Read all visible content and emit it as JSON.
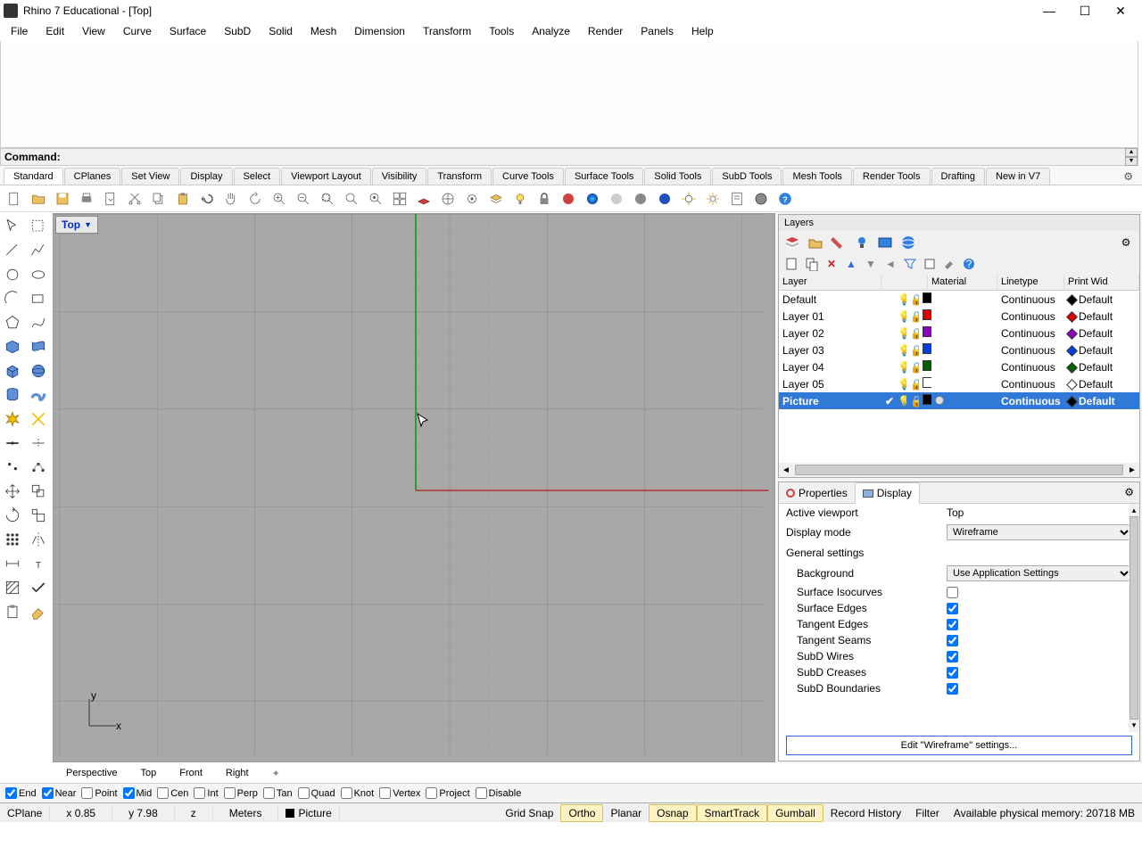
{
  "title": "Rhino 7 Educational - [Top]",
  "menu": [
    "File",
    "Edit",
    "View",
    "Curve",
    "Surface",
    "SubD",
    "Solid",
    "Mesh",
    "Dimension",
    "Transform",
    "Tools",
    "Analyze",
    "Render",
    "Panels",
    "Help"
  ],
  "command_label": "Command:",
  "command_value": "",
  "tabs": [
    "Standard",
    "CPlanes",
    "Set View",
    "Display",
    "Select",
    "Viewport Layout",
    "Visibility",
    "Transform",
    "Curve Tools",
    "Surface Tools",
    "Solid Tools",
    "SubD Tools",
    "Mesh Tools",
    "Render Tools",
    "Drafting",
    "New in V7"
  ],
  "viewport_label": "Top",
  "view_tabs": [
    "Perspective",
    "Top",
    "Front",
    "Right"
  ],
  "layers": {
    "title": "Layers",
    "headers": {
      "layer": "Layer",
      "material": "Material",
      "linetype": "Linetype",
      "printwid": "Print Wid"
    },
    "rows": [
      {
        "name": "Default",
        "color": "#000000",
        "linetype": "Continuous",
        "diamondFill": "#000",
        "print": "Default"
      },
      {
        "name": "Layer 01",
        "color": "#e00000",
        "linetype": "Continuous",
        "diamondFill": "#e00000",
        "print": "Default"
      },
      {
        "name": "Layer 02",
        "color": "#9000c0",
        "linetype": "Continuous",
        "diamondFill": "#9000c0",
        "print": "Default"
      },
      {
        "name": "Layer 03",
        "color": "#0040e0",
        "linetype": "Continuous",
        "diamondFill": "#0040e0",
        "print": "Default"
      },
      {
        "name": "Layer 04",
        "color": "#006000",
        "linetype": "Continuous",
        "diamondFill": "#006000",
        "print": "Default"
      },
      {
        "name": "Layer 05",
        "color": "#ffffff",
        "linetype": "Continuous",
        "diamondFill": "#fff",
        "print": "Default"
      },
      {
        "name": "Picture",
        "color": "#000000",
        "linetype": "Continuous",
        "diamondFill": "#000",
        "print": "Default",
        "selected": true,
        "current": true,
        "mat": "●"
      }
    ]
  },
  "props": {
    "tab_properties": "Properties",
    "tab_display": "Display",
    "active_viewport_label": "Active viewport",
    "active_viewport_value": "Top",
    "display_mode_label": "Display mode",
    "display_mode_value": "Wireframe",
    "general_settings": "General settings",
    "background_label": "Background",
    "background_value": "Use Application Settings",
    "surface_isocurves": "Surface Isocurves",
    "surface_edges": "Surface Edges",
    "tangent_edges": "Tangent Edges",
    "tangent_seams": "Tangent Seams",
    "subd_wires": "SubD Wires",
    "subd_creases": "SubD Creases",
    "subd_boundaries": "SubD Boundaries",
    "edit_button": "Edit \"Wireframe\" settings..."
  },
  "osnap": [
    {
      "label": "End",
      "on": true
    },
    {
      "label": "Near",
      "on": true
    },
    {
      "label": "Point",
      "on": false
    },
    {
      "label": "Mid",
      "on": true
    },
    {
      "label": "Cen",
      "on": false
    },
    {
      "label": "Int",
      "on": false
    },
    {
      "label": "Perp",
      "on": false
    },
    {
      "label": "Tan",
      "on": false
    },
    {
      "label": "Quad",
      "on": false
    },
    {
      "label": "Knot",
      "on": false
    },
    {
      "label": "Vertex",
      "on": false
    },
    {
      "label": "Project",
      "on": false
    },
    {
      "label": "Disable",
      "on": false
    }
  ],
  "status": {
    "cplane": "CPlane",
    "x": "x 0.85",
    "y": "y 7.98",
    "z": "z",
    "units": "Meters",
    "layer": "Picture",
    "gridsnap": "Grid Snap",
    "ortho": "Ortho",
    "planar": "Planar",
    "osnap": "Osnap",
    "smarttrack": "SmartTrack",
    "gumball": "Gumball",
    "history": "Record History",
    "filter": "Filter",
    "memory": "Available physical memory: 20718 MB"
  }
}
